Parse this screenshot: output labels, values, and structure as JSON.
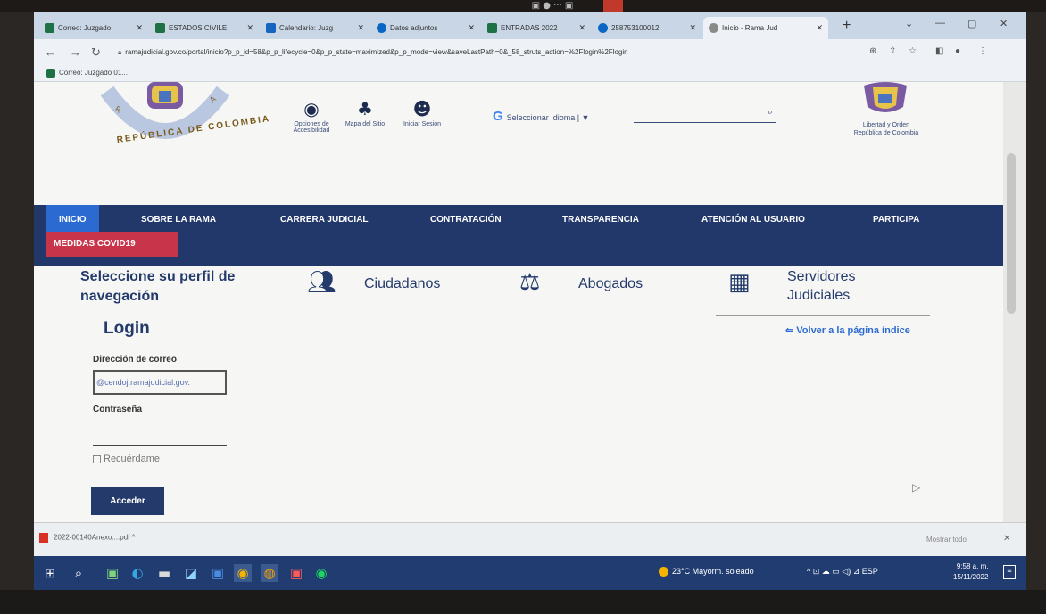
{
  "tabs": [
    {
      "label": "Correo: Juzgado",
      "color": "#1e7145"
    },
    {
      "label": "ESTADOS CIVILE",
      "color": "#1e7145"
    },
    {
      "label": "Calendario: Juzg",
      "color": "#1565c0"
    },
    {
      "label": "Datos adjuntos",
      "color": "#0a66c2"
    },
    {
      "label": "ENTRADAS 2022",
      "color": "#1e7145"
    },
    {
      "label": "258753100012",
      "color": "#0a66c2"
    },
    {
      "label": "Inicio - Rama Jud",
      "color": "#8a8a8a"
    }
  ],
  "address": {
    "url": "ramajudicial.gov.co/portal/inicio?p_p_id=58&p_p_lifecycle=0&p_p_state=maximized&p_p_mode=view&saveLastPath=0&_58_struts_action=%2Flogin%2Flogin"
  },
  "bookmarks": {
    "item": "Correo: Juzgado 01..."
  },
  "header": {
    "seal_text": "REPÚBLICA DE COLOMBIA",
    "accessibility_label": "Opciones de Accesibilidad",
    "sitemap_label": "Mapa del Sitio",
    "login_label": "Iniciar Sesión",
    "translate_label": "Seleccionar Idioma | ▼",
    "translate_g": "G",
    "motto": "Libertad y Orden",
    "country": "República de Colombia"
  },
  "nav": {
    "items": [
      "INICIO",
      "SOBRE LA RAMA",
      "CARRERA JUDICIAL",
      "CONTRATACIÓN",
      "TRANSPARENCIA",
      "ATENCIÓN AL USUARIO",
      "PARTICIPA"
    ],
    "covid": "MEDIDAS COVID19"
  },
  "profile": {
    "title": "Seleccione su perfil de navegación",
    "options": [
      "Ciudadanos",
      "Abogados",
      "Servidores Judiciales"
    ]
  },
  "login": {
    "title": "Login",
    "back": "⇐ Volver a la página índice",
    "email_label": "Dirección de correo",
    "email_value": "@cendoj.ramajudicial.gov.",
    "password_label": "Contraseña",
    "remember_label": "Recuérdame",
    "submit_label": "Acceder"
  },
  "downloads": {
    "file": "2022-00140Anexo....pdf",
    "show_all": "Mostrar todo"
  },
  "taskbar": {
    "weather": "23°C Mayorm. soleado",
    "tray": "^ ⊡ ☁ ▭ ◁) ⊿ ESP",
    "time": "9:58 a. m.",
    "date": "15/11/2022"
  }
}
